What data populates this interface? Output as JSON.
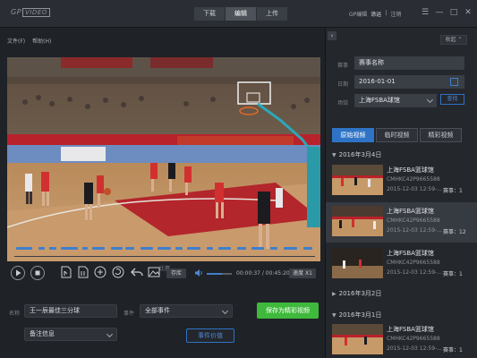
{
  "app": {
    "logo_text": "GP",
    "logo_box": "VIDEO"
  },
  "top_tabs": [
    {
      "label": "下载"
    },
    {
      "label": "编辑"
    },
    {
      "label": "上传"
    }
  ],
  "user": {
    "brand": "GP编辑",
    "name": "涂运",
    "action": "注销"
  },
  "window_controls": {
    "skin": "☰",
    "minimize": "—",
    "maximize": "□",
    "close": "✕"
  },
  "file_menu": {
    "file": "文件(F)",
    "help": "帮助(H)"
  },
  "player": {
    "timeline_label": "比赛",
    "timecode": "00:00:37 / 00:45:20",
    "save_frame_label": "存库",
    "speed_label": "速度 X1",
    "volume": 0.6,
    "segments": [
      [
        0.005,
        0.06
      ],
      [
        0.08,
        0.1
      ],
      [
        0.115,
        0.14
      ],
      [
        0.155,
        0.21
      ],
      [
        0.225,
        0.245
      ],
      [
        0.26,
        0.3
      ],
      [
        0.32,
        0.36
      ],
      [
        0.37,
        0.4
      ],
      [
        0.42,
        0.46
      ],
      [
        0.475,
        0.52
      ],
      [
        0.535,
        0.56
      ],
      [
        0.575,
        0.62
      ],
      [
        0.64,
        0.66
      ],
      [
        0.68,
        0.72
      ],
      [
        0.74,
        0.77
      ],
      [
        0.79,
        0.83
      ],
      [
        0.85,
        0.875
      ],
      [
        0.895,
        0.94
      ],
      [
        0.96,
        0.99
      ]
    ]
  },
  "clip_form": {
    "name_label": "名称",
    "name_value": "王一辰最佳三分球",
    "event_label": "事件",
    "event_value": "全部事件",
    "note_value": "备注信息",
    "save_button": "保存为精彩视频",
    "event_tag_button": "事件价值"
  },
  "search_panel": {
    "collapse_button": "收起",
    "event_label": "赛事",
    "event_value": "赛事名称",
    "date_label": "日期",
    "date_value": "2016-01-01",
    "venue_label": "场馆",
    "venue_value": "上海FSBA球馆",
    "search_button": "查找"
  },
  "video_tabs": [
    {
      "label": "原始视频"
    },
    {
      "label": "临时视频"
    },
    {
      "label": "精彩视频"
    }
  ],
  "date_groups": [
    {
      "date": "2016年3月4日",
      "clips": [
        {
          "title": "上海FSBA篮球馆",
          "code": "CMHKC42P9665588",
          "time": "2015-12-03 12:59-...",
          "event": "赛事：1"
        },
        {
          "title": "上海FSBA篮球馆",
          "code": "CMHKC42P9665588",
          "time": "2015-12-03 12:59-...",
          "event": "赛事：12"
        },
        {
          "title": "上海FSBA篮球馆",
          "code": "CMHKC42P9665588",
          "time": "2015-12-03 12:59-...",
          "event": "赛事：1"
        }
      ]
    },
    {
      "date": "2016年3月2日",
      "clips": []
    },
    {
      "date": "2016年3月1日",
      "clips": [
        {
          "title": "上海FSBA篮球馆",
          "code": "CMHKC42P9665588",
          "time": "2015-12-03 12:59-...",
          "event": "赛事：1"
        }
      ]
    }
  ]
}
